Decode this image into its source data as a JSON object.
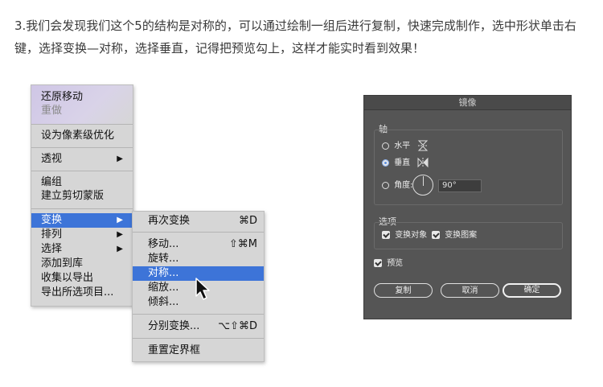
{
  "intro_text": "3.我们会发现我们这个5的结构是对称的，可以通过绘制一组后进行复制，快速完成制作，选中形状单击右键，选择变换—对称，选择垂直，记得把预览勾上，这样才能实时看到效果！",
  "context_menu": {
    "undo_move": "还原移动",
    "redo": "重做",
    "pixel_optimize": "设为像素级优化",
    "perspective": "透视",
    "group": "编组",
    "clipping_mask": "建立剪切蒙版",
    "transform": "变换",
    "arrange": "排列",
    "select": "选择",
    "add_to_library": "添加到库",
    "collect_export": "收集以导出",
    "export_selection": "导出所选项目...",
    "arrow": "▶"
  },
  "submenu": {
    "transform_again": "再次变换",
    "transform_again_shortcut": "⌘D",
    "move": "移动...",
    "move_shortcut": "⇧⌘M",
    "rotate": "旋转...",
    "reflect": "对称...",
    "scale": "缩放...",
    "shear": "倾斜...",
    "transform_each": "分别变换...",
    "transform_each_shortcut": "⌥⇧⌘D",
    "reset_bounding_box": "重置定界框"
  },
  "dialog": {
    "title": "镜像",
    "axis_label": "轴",
    "horizontal": "水平",
    "vertical": "垂直",
    "angle": "角度:",
    "angle_value": "90°",
    "options_label": "选项",
    "transform_objects": "变换对象",
    "transform_patterns": "变换图案",
    "preview": "预览",
    "copy": "复制",
    "cancel": "取消",
    "ok": "确定"
  },
  "colors": {
    "menu_highlight": "#3d74d8",
    "dialog_bg": "#555555",
    "radio_selected": "#5b8fe0"
  }
}
